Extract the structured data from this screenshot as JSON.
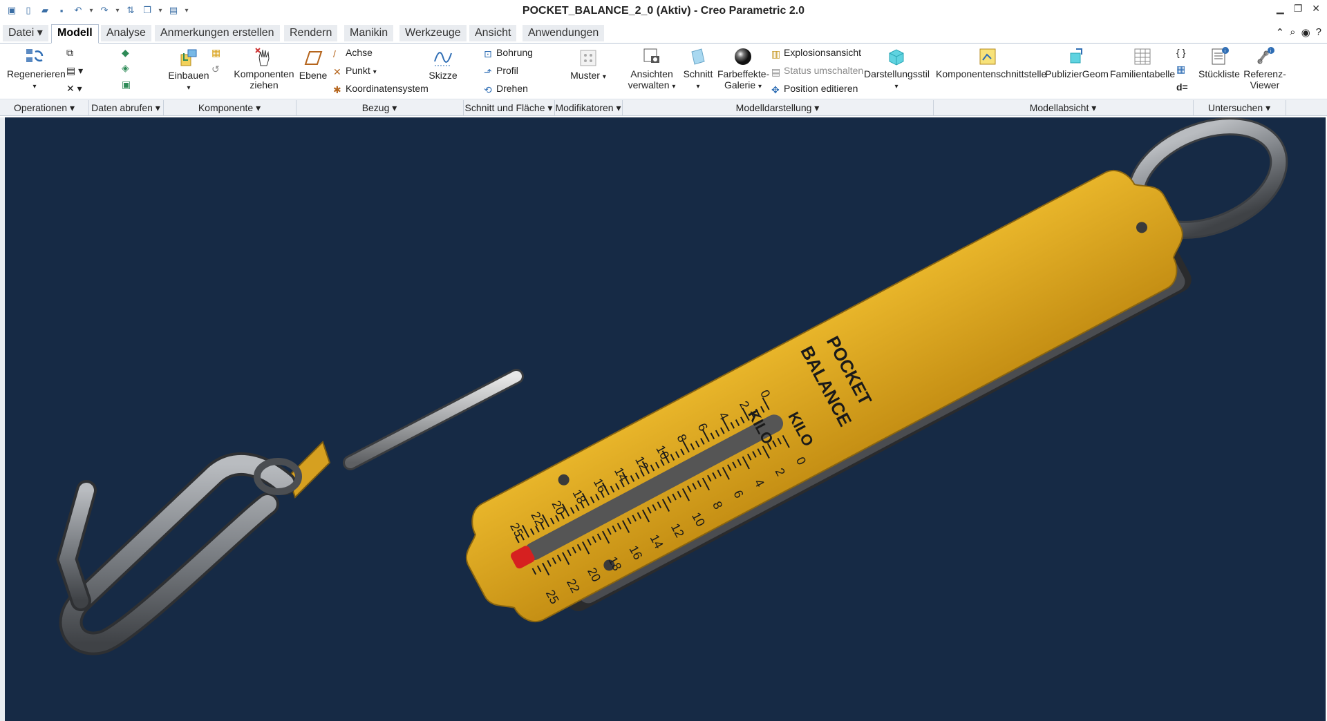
{
  "window": {
    "title": "POCKET_BALANCE_2_0 (Aktiv) - Creo Parametric 2.0"
  },
  "tabs": [
    {
      "label": "Datei",
      "active": false
    },
    {
      "label": "Modell",
      "active": true
    },
    {
      "label": "Analyse",
      "active": false
    },
    {
      "label": "Anmerkungen erstellen",
      "active": false
    },
    {
      "label": "Rendern",
      "active": false
    },
    {
      "label": "Manikin",
      "active": false
    },
    {
      "label": "Werkzeuge",
      "active": false
    },
    {
      "label": "Ansicht",
      "active": false
    },
    {
      "label": "Anwendungen",
      "active": false
    }
  ],
  "ribbon": {
    "regenerieren": "Regenerieren",
    "einbauen": "Einbauen",
    "komponenten_ziehen": [
      "Komponenten",
      "ziehen"
    ],
    "ebene": "Ebene",
    "achse": "Achse",
    "punkt": "Punkt",
    "koordinatensystem": "Koordinatensystem",
    "skizze": "Skizze",
    "bohrung": "Bohrung",
    "profil": "Profil",
    "drehen": "Drehen",
    "muster": "Muster",
    "ansichten_verwalten": [
      "Ansichten",
      "verwalten"
    ],
    "schnitt": "Schnitt",
    "farbeffekte_galerie": [
      "Farbeffekte-",
      "Galerie"
    ],
    "explosionsansicht": "Explosionsansicht",
    "status_umschalten": "Status umschalten",
    "position_editieren": "Position editieren",
    "darstellungsstil": "Darstellungsstil",
    "komponentenschnittstelle": "Komponentenschnittstelle",
    "publiziergeom": "PublizierGeom",
    "familientabelle": "Familientabelle",
    "stueckliste": "Stückliste",
    "referenz_viewer": [
      "Referenz-",
      "Viewer"
    ],
    "d_equals": "d="
  },
  "groups": [
    "Operationen",
    "Daten abrufen",
    "Komponente",
    "Bezug",
    "Schnitt und Fläche",
    "Modifikatoren",
    "Modelldarstellung",
    "Modellabsicht",
    "Untersuchen"
  ],
  "model": {
    "label_pocket": "POCKET",
    "label_balance": "BALANCE",
    "label_kilo": "KILO",
    "scale_values": [
      "0",
      "2",
      "4",
      "6",
      "8",
      "10",
      "12",
      "14",
      "16",
      "18",
      "20",
      "22",
      "25"
    ]
  },
  "colors": {
    "viewport_bg": "#162a45",
    "scale_plate": "#d9a31e",
    "steel": "#7b7f84",
    "brass": "#d6a020"
  }
}
